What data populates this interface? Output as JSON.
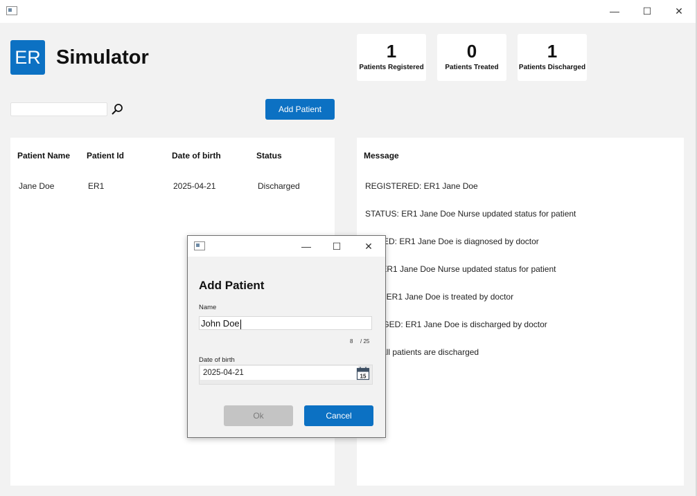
{
  "window": {
    "controls": [
      "—",
      "☐",
      "✕"
    ]
  },
  "header": {
    "logo_text": "ER",
    "title": "Simulator"
  },
  "stats": [
    {
      "value": "1",
      "label": "Patients Registered"
    },
    {
      "value": "0",
      "label": "Patients Treated"
    },
    {
      "value": "1",
      "label": "Patients Discharged"
    }
  ],
  "search": {
    "value": "",
    "icon": "search-icon"
  },
  "toolbar": {
    "add_label": "Add Patient"
  },
  "patients_table": {
    "headers": [
      "Patient Name",
      "Patient Id",
      "Date of birth",
      "Status"
    ],
    "rows": [
      {
        "name": "Jane Doe",
        "id": "ER1",
        "dob": "2025-04-21",
        "status": "Discharged"
      }
    ]
  },
  "messages": {
    "header": "Message",
    "items": [
      "REGISTERED: ER1 Jane Doe",
      "STATUS: ER1 Jane Doe Nurse updated status for patient",
      "NOSED: ER1 Jane Doe is diagnosed by doctor",
      "US: ER1 Jane Doe Nurse updated status for patient",
      "TED: ER1 Jane Doe is treated by doctor",
      "HARGED: ER1 Jane Doe is discharged by doctor",
      "US: All patients are discharged"
    ]
  },
  "dialog": {
    "controls": [
      "—",
      "☐",
      "✕"
    ],
    "title": "Add Patient",
    "name_label": "Name",
    "name_value": "John Doe",
    "char_count": "8",
    "char_max": "/ 25",
    "dob_label": "Date of birth",
    "dob_value": "2025-04-21",
    "calendar_day": "15",
    "ok_label": "Ok",
    "cancel_label": "Cancel"
  },
  "colors": {
    "accent": "#0c71c3",
    "disabled": "#c4c4c4",
    "background": "#f2f2f2"
  }
}
